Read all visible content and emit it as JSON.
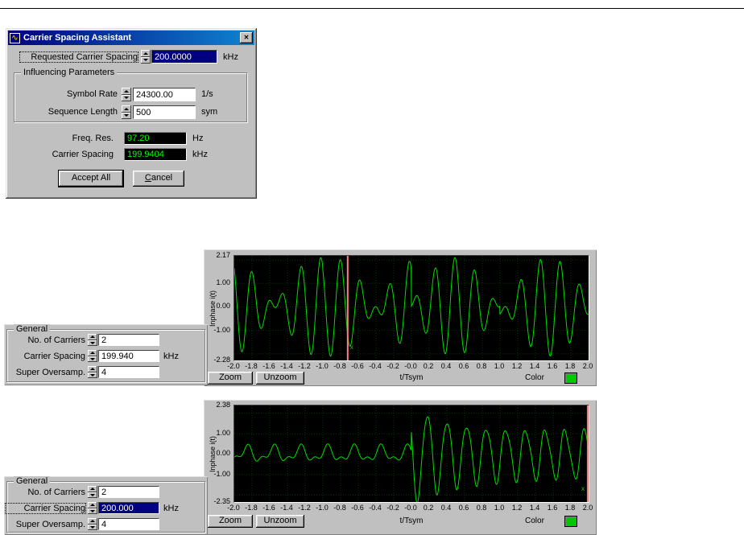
{
  "colors": {
    "window_gray": "#c0c0c0",
    "titlebar_blue": "#000080",
    "led_green": "#00ff00",
    "trace_green": "#00dd00",
    "cursor_pink": "#ff8080",
    "selection_blue": "#000080"
  },
  "dialog": {
    "title": "Carrier Spacing Assistant",
    "close_glyph": "✕",
    "icon_glyph": "∿",
    "requested": {
      "label": "Requested Carrier Spacing",
      "value": "200.0000",
      "unit": "kHz"
    },
    "group_title": "Influencing Parameters",
    "symbol_rate": {
      "label": "Symbol Rate",
      "value": "24300.00",
      "unit": "1/s"
    },
    "sequence_length": {
      "label": "Sequence Length",
      "value": "500",
      "unit": "sym"
    },
    "freq_res": {
      "label": "Freq. Res.",
      "value": "97.20",
      "unit": "Hz"
    },
    "carrier_spacing": {
      "label": "Carrier Spacing",
      "value": "199.9404",
      "unit": "kHz"
    },
    "accept_label": "Accept All",
    "cancel_label": "Cancel"
  },
  "general_panels": [
    {
      "title": "General",
      "rows": [
        {
          "label": "No. of Carriers",
          "value": "2",
          "unit": ""
        },
        {
          "label": "Carrier Spacing",
          "value": "199.940",
          "unit": "kHz"
        },
        {
          "label": "Super Oversamp.",
          "value": "4",
          "unit": ""
        }
      ]
    },
    {
      "title": "General",
      "rows": [
        {
          "label": "No. of Carriers",
          "value": "2",
          "unit": ""
        },
        {
          "label": "Carrier Spacing",
          "value": "200.000",
          "unit": "kHz"
        },
        {
          "label": "Super Oversamp.",
          "value": "4",
          "unit": ""
        }
      ]
    }
  ],
  "chart_data": [
    {
      "type": "line",
      "title": "",
      "ylabel": "Inphase i(t)",
      "xlabel": "t/Tsym",
      "xlim": [
        -2.0,
        2.0
      ],
      "ylim": [
        -2.28,
        2.17
      ],
      "yticks": [
        "2.17",
        "1.00",
        "0.00",
        "-1.00",
        "-2.28"
      ],
      "xticks": [
        "-2.0",
        "-1.8",
        "-1.6",
        "-1.4",
        "-1.2",
        "-1.0",
        "-0.8",
        "-0.6",
        "-0.4",
        "-0.2",
        "-0.0",
        "0.2",
        "0.4",
        "0.6",
        "0.8",
        "1.0",
        "1.2",
        "1.4",
        "1.6",
        "1.8",
        "2.0"
      ],
      "grid": true,
      "legend_position": "none",
      "cursor": {
        "x": -0.72,
        "label": "x"
      },
      "buttons": {
        "zoom": "Zoom",
        "unzoom": "Unzoom"
      },
      "color_label": "Color",
      "swatch_color": "#00c800",
      "trace_color": "#00dd00",
      "grid_color": "#003a00",
      "cursor_color": "#ff8080",
      "waveform": {
        "kind": "ofdm",
        "amp": 1.05,
        "f1": 4.0,
        "f2": 5.0,
        "phases_a": [
          0.5,
          1.0,
          0.2,
          1.4
        ],
        "phases_b": [
          0.81,
          6.65,
          -2.82,
          4.23
        ]
      }
    },
    {
      "type": "line",
      "title": "",
      "ylabel": "Inphase i(t)",
      "xlabel": "t/Tsym",
      "xlim": [
        -2.0,
        2.0
      ],
      "ylim": [
        -2.35,
        2.38
      ],
      "yticks": [
        "2.38",
        "1.00",
        "0.00",
        "-1.00",
        "-2.35"
      ],
      "xticks": [
        "-2.0",
        "-1.8",
        "-1.6",
        "-1.4",
        "-1.2",
        "-1.0",
        "-0.8",
        "-0.6",
        "-0.4",
        "-0.2",
        "-0.0",
        "0.2",
        "0.4",
        "0.6",
        "0.8",
        "1.0",
        "1.2",
        "1.4",
        "1.6",
        "1.8",
        "2.0"
      ],
      "grid": true,
      "legend_position": "none",
      "cursor": {
        "x": 1.99,
        "label": "x"
      },
      "buttons": {
        "zoom": "Zoom",
        "unzoom": "Unzoom"
      },
      "color_label": "Color",
      "swatch_color": "#00c800",
      "trace_color": "#00dd00",
      "grid_color": "#003a00",
      "cursor_color": "#ff8080",
      "waveform": {
        "kind": "burst",
        "pre": [
          [
            0.32,
            3.3,
            0.8
          ],
          [
            0.18,
            6.7,
            2.0
          ]
        ],
        "env": [
          1.15,
          1.25,
          2.2
        ],
        "main": [
          1.0,
          4.5,
          1.2
        ],
        "ripple": [
          0.2,
          8.8,
          0.0
        ]
      }
    }
  ]
}
